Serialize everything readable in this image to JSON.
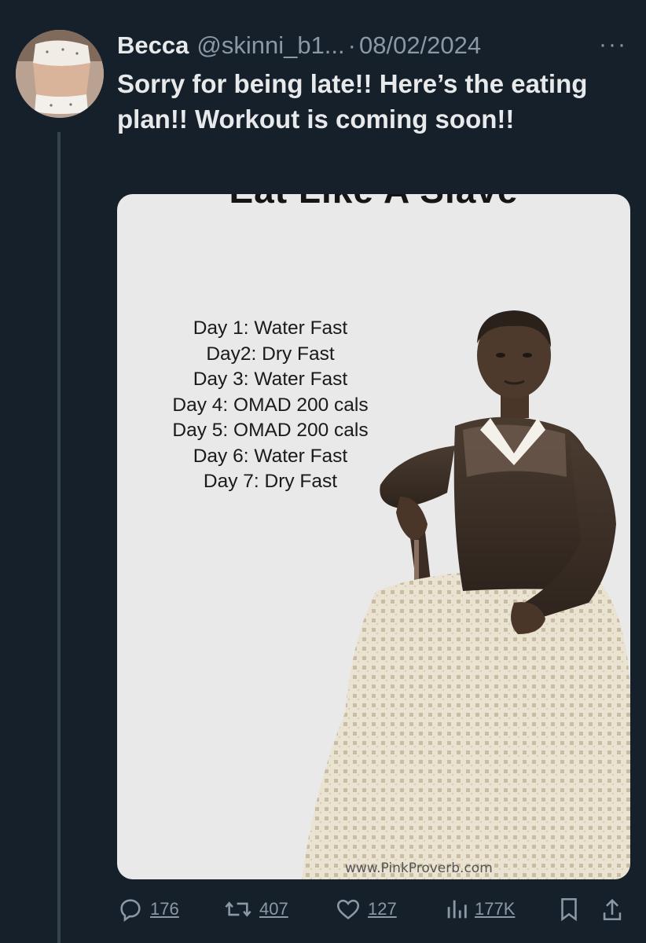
{
  "tweet": {
    "display_name": "Becca",
    "handle": "@skinni_b1...",
    "separator": "·",
    "date": "08/02/2024",
    "text": "Sorry for being late!! Here’s the eating plan!! Workout is coming soon!!",
    "more_icon": "more-horizontal-icon"
  },
  "media": {
    "title": "Eat Like A Slave",
    "plan": [
      "Day 1: Water Fast",
      "Day2: Dry Fast",
      "Day 3: Water Fast",
      "Day 4: OMAD 200 cals",
      "Day 5: OMAD 200 cals",
      "Day 6: Water Fast",
      "Day 7: Dry Fast"
    ],
    "watermark": "www.PinkProverb.com"
  },
  "actions": {
    "replies": "176",
    "retweets": "407",
    "likes": "127",
    "views": "177K",
    "bookmark_icon": "bookmark-icon",
    "share_icon": "share-icon"
  },
  "colors": {
    "background": "#15202b",
    "text_primary": "#e7e9ea",
    "text_secondary": "#8b98a5",
    "media_bg": "#e9e9ea"
  }
}
